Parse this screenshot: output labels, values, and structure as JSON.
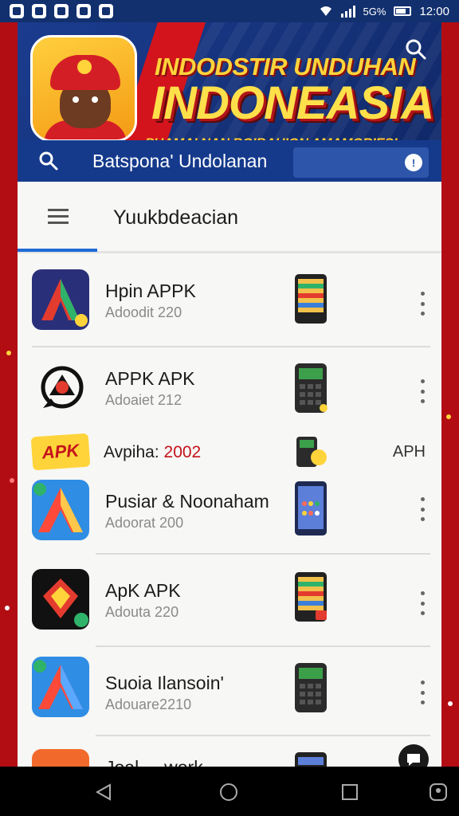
{
  "status_bar": {
    "time": "12:00",
    "network": "5G%"
  },
  "banner": {
    "line1": "INDODSTIR UNDUHAN",
    "line2": "INDONEASIA",
    "line3": "PUAMAI NAN BOIBAHION AMAMORIES!",
    "search_text": "Batspona' Undolanan"
  },
  "app_bar": {
    "title": "Yuukbdeacian"
  },
  "apps": [
    {
      "title": "Hpin APPK",
      "subtitle": "Adoodit 220"
    },
    {
      "title": "APPK APK",
      "subtitle": "Adoaiet 212"
    },
    {
      "title": "Pusiar & Noonaham",
      "subtitle": "Adoorat 200"
    },
    {
      "title": "ApK APK",
      "subtitle": "Adouta 220"
    },
    {
      "title": "Suoia Ilansoin'",
      "subtitle": "Adouare2210"
    },
    {
      "title": "Joal ... work",
      "subtitle": ""
    }
  ],
  "promo": {
    "badge": "APK",
    "label": "Avpiha:",
    "year": "2002",
    "right": "APH"
  },
  "colors": {
    "frame_red": "#b30d14",
    "banner_blue": "#15327a",
    "accent_yellow": "#ffd43b",
    "indicator_blue": "#1e6ad6"
  }
}
